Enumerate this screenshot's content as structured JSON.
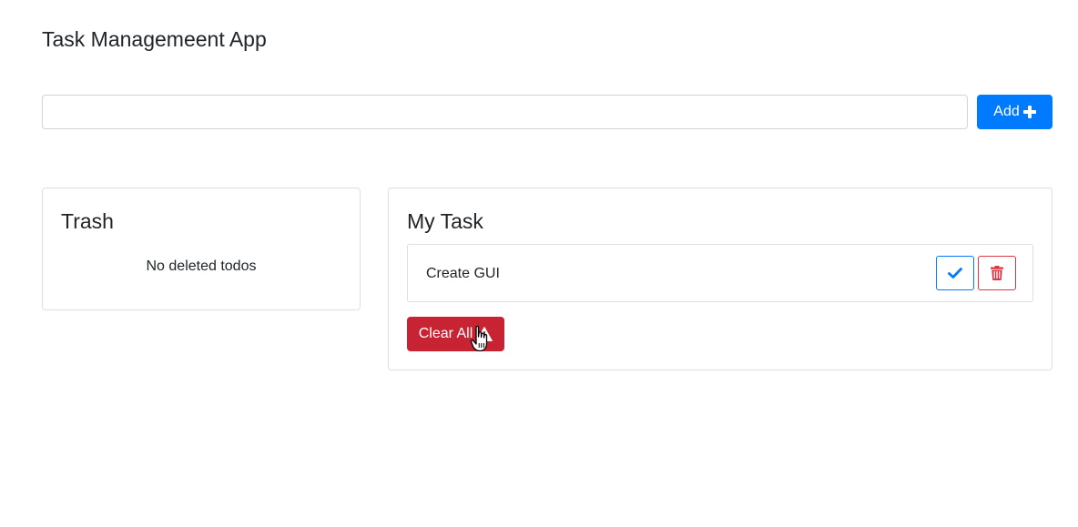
{
  "app": {
    "title": "Task Managemeent App"
  },
  "add_form": {
    "input_value": "",
    "input_placeholder": "",
    "add_label": "Add",
    "add_icon": "plus-icon"
  },
  "trash": {
    "title": "Trash",
    "empty_text": "No deleted todos"
  },
  "tasks": {
    "title": "My Task",
    "items": [
      {
        "text": "Create GUI",
        "complete_icon": "check-icon",
        "delete_icon": "trash-icon"
      }
    ],
    "clear_label": "Clear All",
    "clear_icon": "warning-icon"
  },
  "colors": {
    "primary": "#007bff",
    "danger": "#c82333",
    "danger_outline": "#dc3545",
    "border": "#dfdfdf",
    "text": "#212529"
  },
  "cursor": "hand-pointer-icon"
}
